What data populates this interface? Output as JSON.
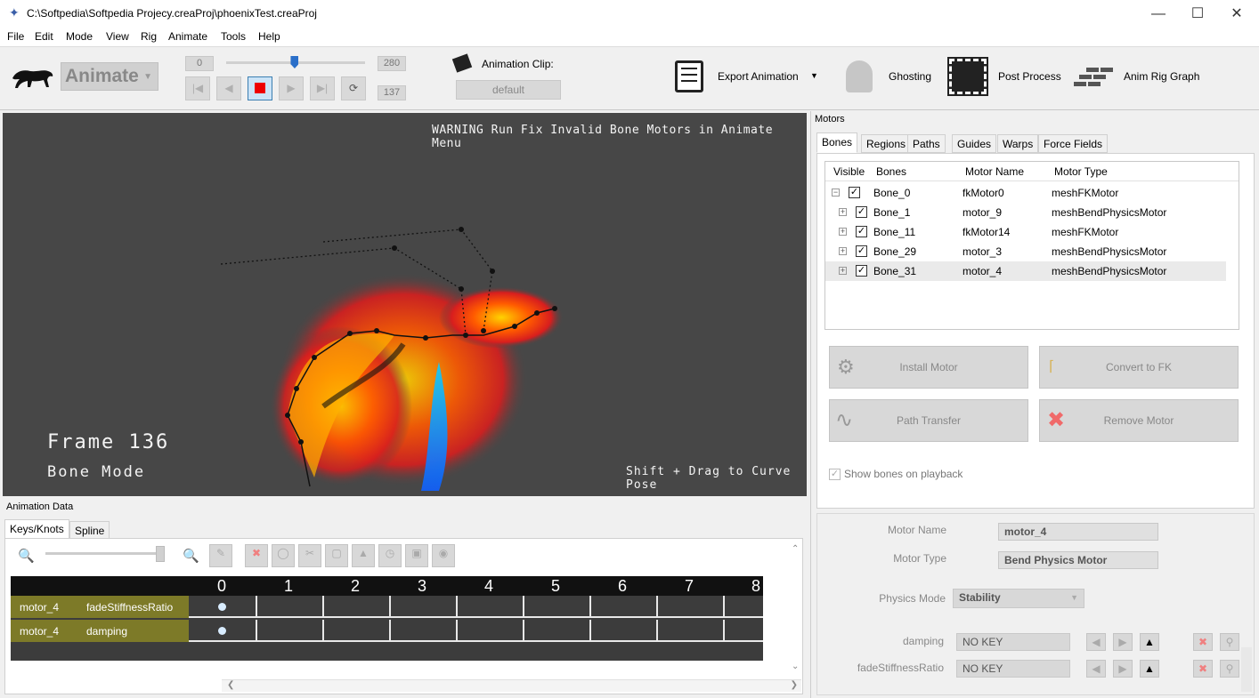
{
  "window": {
    "title": "C:\\Softpedia\\Softpedia Projecy.creaProj\\phoenixTest.creaProj",
    "min_icon": "minimize-icon",
    "max_icon": "maximize-icon",
    "close_icon": "close-icon"
  },
  "menu": [
    "File",
    "Edit",
    "Mode",
    "View",
    "Rig",
    "Animate",
    "Tools",
    "Help"
  ],
  "toolbar": {
    "mode": "Animate",
    "frame_min": "0",
    "frame_max": "280",
    "frame_current": "137",
    "slider_fraction": 0.49,
    "animation_clip_label": "Animation Clip:",
    "animation_clip_value": "default",
    "export_label": "Export Animation",
    "ghosting_label": "Ghosting",
    "post_process_label": "Post Process",
    "anim_rig_graph_label": "Anim Rig Graph"
  },
  "viewport": {
    "warning": "WARNING Run Fix Invalid Bone Motors in Animate Menu",
    "frame_text": "Frame 136",
    "mode_text": "Bone Mode",
    "hint": "Shift + Drag to Curve Pose"
  },
  "motors": {
    "panel_title": "Motors",
    "tabs": [
      "Bones",
      "Regions",
      "Paths",
      "Guides",
      "Warps",
      "Force Fields"
    ],
    "columns": [
      "Visible",
      "Bones",
      "Motor Name",
      "Motor Type"
    ],
    "rows": [
      {
        "bone": "Bone_0",
        "motor": "fkMotor0",
        "type": "meshFKMotor",
        "expander": "−"
      },
      {
        "bone": "Bone_1",
        "motor": "motor_9",
        "type": "meshBendPhysicsMotor",
        "expander": "+"
      },
      {
        "bone": "Bone_11",
        "motor": "fkMotor14",
        "type": "meshFKMotor",
        "expander": "+"
      },
      {
        "bone": "Bone_29",
        "motor": "motor_3",
        "type": "meshBendPhysicsMotor",
        "expander": "+"
      },
      {
        "bone": "Bone_31",
        "motor": "motor_4",
        "type": "meshBendPhysicsMotor",
        "expander": "+"
      }
    ],
    "buttons": {
      "install": "Install Motor",
      "convert": "Convert to FK",
      "path_transfer": "Path Transfer",
      "remove": "Remove Motor"
    },
    "show_bones_label": "Show bones on playback"
  },
  "properties": {
    "motor_name_label": "Motor Name",
    "motor_name_value": "motor_4",
    "motor_type_label": "Motor Type",
    "motor_type_value": "Bend Physics Motor",
    "physics_mode_label": "Physics Mode",
    "physics_mode_value": "Stability",
    "params": [
      {
        "label": "damping",
        "value": "NO KEY"
      },
      {
        "label": "fadeStiffnessRatio",
        "value": "NO KEY"
      }
    ]
  },
  "animdata": {
    "panel_title": "Animation Data",
    "tabs": [
      "Keys/Knots",
      "Spline"
    ],
    "frames": [
      "0",
      "1",
      "2",
      "3",
      "4",
      "5",
      "6",
      "7",
      "8"
    ],
    "tracks": [
      {
        "motor": "motor_4",
        "param": "fadeStiffnessRatio"
      },
      {
        "motor": "motor_4",
        "param": "damping"
      }
    ]
  },
  "colors": {
    "track_bg": "#7d7a28",
    "grid_bg": "#3c3c3c",
    "accent": "#2a6fc9",
    "stop": "#e00000"
  }
}
